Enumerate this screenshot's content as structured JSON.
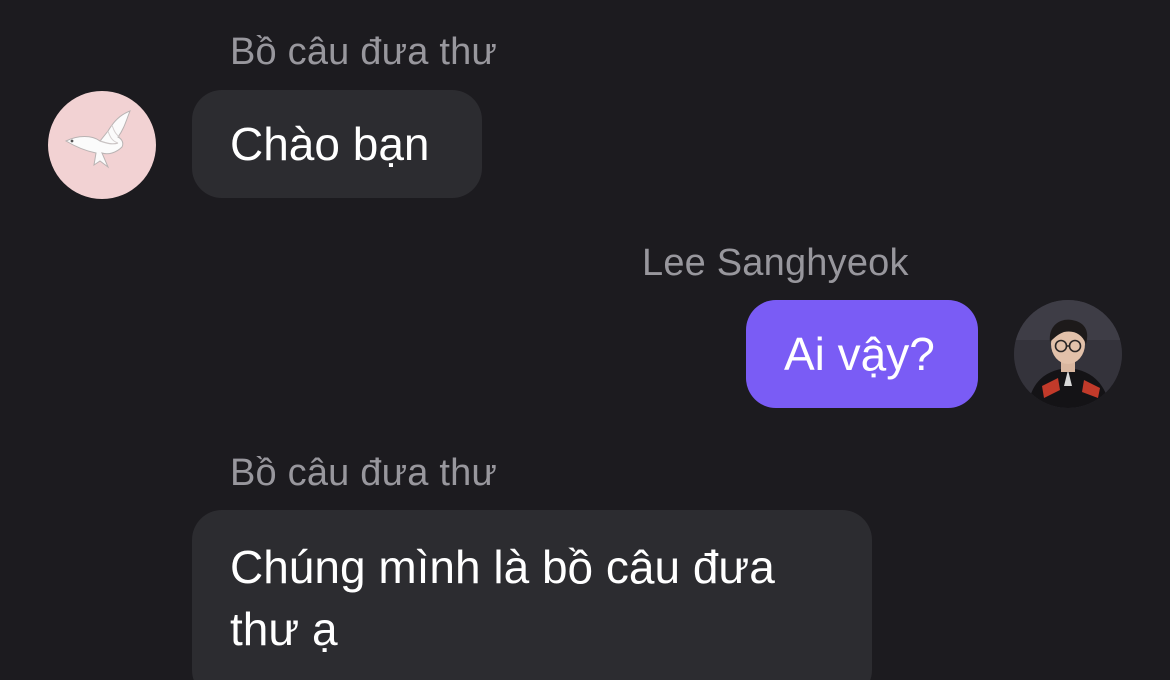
{
  "messages": [
    {
      "sender": "Bồ câu đưa thư",
      "text": "Chào bạn",
      "direction": "incoming",
      "avatar_icon": "dove-icon"
    },
    {
      "sender": "Lee Sanghyeok",
      "text": "Ai vậy?",
      "direction": "outgoing",
      "avatar_icon": "user-photo-avatar"
    },
    {
      "sender": "Bồ câu đưa thư",
      "text_line1": "Chúng mình là bồ câu đưa",
      "text_line2": "thư ạ",
      "direction": "incoming"
    }
  ],
  "colors": {
    "background": "#1c1b1f",
    "incoming_bubble": "#2c2c30",
    "outgoing_bubble": "#7a5cf5",
    "sender_name": "#98979d",
    "dove_avatar_bg": "#f2d2d3"
  }
}
